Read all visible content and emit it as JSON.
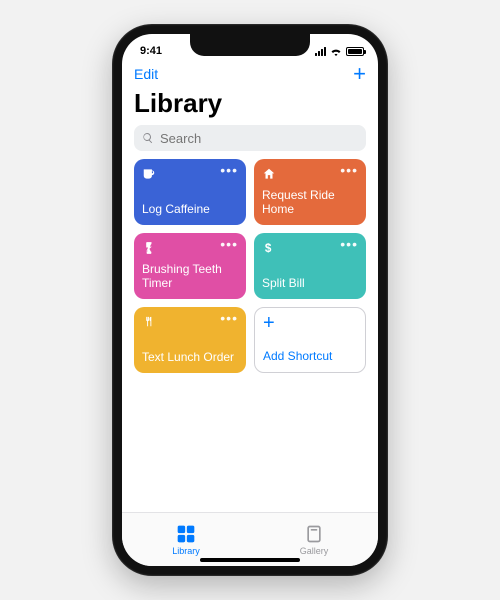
{
  "status": {
    "time": "9:41"
  },
  "nav": {
    "edit": "Edit"
  },
  "title": "Library",
  "search": {
    "placeholder": "Search"
  },
  "tiles": [
    {
      "label": "Log Caffeine",
      "color": "#3a63d6",
      "icon": "cup"
    },
    {
      "label": "Request Ride Home",
      "color": "#e46a3c",
      "icon": "home"
    },
    {
      "label": "Brushing Teeth Timer",
      "color": "#e04fa5",
      "icon": "timer"
    },
    {
      "label": "Split Bill",
      "color": "#3fc0b8",
      "icon": "dollar"
    },
    {
      "label": "Text Lunch Order",
      "color": "#f0b32f",
      "icon": "utensils"
    }
  ],
  "add_tile": {
    "label": "Add Shortcut"
  },
  "tabs": {
    "library": "Library",
    "gallery": "Gallery"
  }
}
